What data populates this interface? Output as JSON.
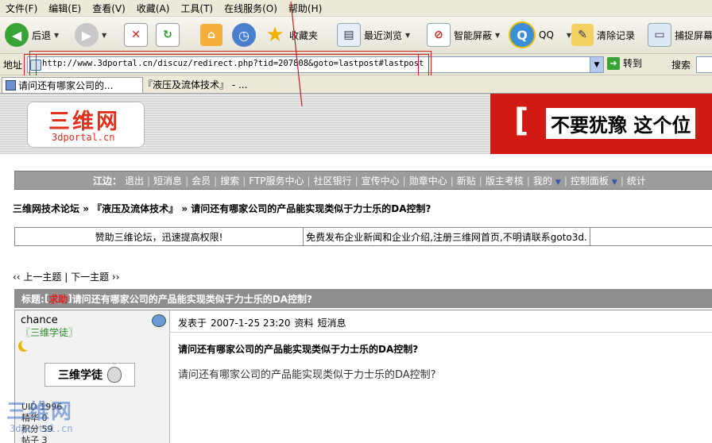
{
  "menu": [
    "文件(F)",
    "编辑(E)",
    "查看(V)",
    "收藏(A)",
    "工具(T)",
    "在线服务(O)",
    "帮助(H)"
  ],
  "toolbar": {
    "back": "后退",
    "favorites": "收藏夹",
    "recent": "最近浏览",
    "smart_block": "智能屏蔽",
    "qq": "QQ",
    "clear_history": "清除记录",
    "capture": "捕捉屏幕"
  },
  "address": {
    "label": "地址",
    "url": "http://www.3dportal.cn/discuz/redirect.php?tid=207808&goto=lastpost#lastpost",
    "go": "转到",
    "search": "搜索"
  },
  "tabs": [
    {
      "label": "请问还有哪家公司的..."
    },
    {
      "label": "『液压及流体技术』 - ..."
    }
  ],
  "header": {
    "logo_main": "三维网",
    "logo_sub": "3dportal.cn",
    "banner_bracket": "[",
    "banner_text": "不要犹豫 这个位"
  },
  "nav": {
    "user_label": "江边：",
    "items": [
      "退出",
      "短消息",
      "会员",
      "搜索",
      "FTP服务中心",
      "社区银行",
      "宣传中心",
      "勋章中心",
      "新贴",
      "版主考核",
      "我的",
      "控制面板",
      "统计"
    ]
  },
  "breadcrumb": {
    "forum": "三维网技术论坛",
    "sep1": " » ",
    "board": "『液压及流体技术』",
    "sep2": " » ",
    "thread": "请问还有哪家公司的产品能实现类似于力士乐的DA控制?"
  },
  "notice": {
    "left": "赞助三维论坛，迅速提高权限!",
    "right": "免费发布企业新闻和企业介绍,注册三维网首页,不明请联系goto3d."
  },
  "pager": {
    "prev": "‹‹ 上一主题",
    "sep": " | ",
    "next": "下一主题 ››"
  },
  "thread": {
    "label": "标题: ",
    "tag_open": "[",
    "tag": "求助",
    "tag_close": "] ",
    "title": "请问还有哪家公司的产品能实现类似于力士乐的DA控制?"
  },
  "post": {
    "author": "chance",
    "author_title": "〖三维学徒〗",
    "rank_badge": "三维学徒",
    "stats": [
      "UID 1996",
      "精华 0",
      "积分 59",
      "帖子 3"
    ],
    "posted_prefix": "发表于",
    "date": "2007-1-25 23:20",
    "profile": "资料",
    "pm": "短消息",
    "subject": "请问还有哪家公司的产品能实现类似于力士乐的DA控制?",
    "body": "请问还有哪家公司的产品能实现类似于力士乐的DA控制?"
  },
  "watermark": {
    "main": "三维网",
    "sub": "3dportal.cn"
  },
  "colors": {
    "nav_bg": "#9c9c9c",
    "title_bar": "#8e8e8e",
    "brand_red": "#d21914",
    "annotation_red": "#d02020"
  }
}
